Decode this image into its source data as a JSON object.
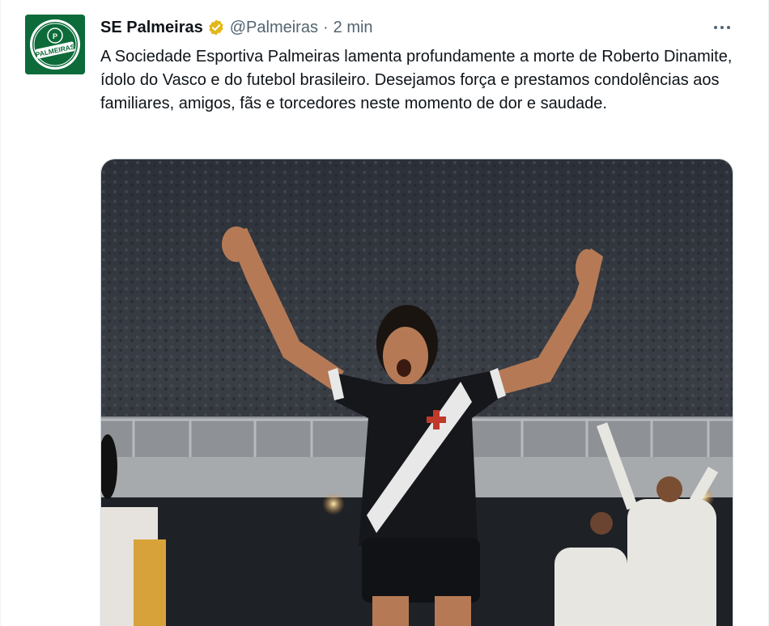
{
  "tweet": {
    "author_name": "SE Palmeiras",
    "handle": "@Palmeiras",
    "separator": "·",
    "time": "2 min",
    "text": "A Sociedade Esportiva Palmeiras lamenta profundamente a morte de Roberto Dinamite, ídolo do Vasco e do futebol brasileiro. Desejamos força e prestamos condolências aos familiares, amigos, fãs e torcedores neste momento de dor e saudade.",
    "avatar_text": "PALMEIRAS",
    "verified_icon": "verified-badge-gold",
    "more_icon": "more-horizontal-icon"
  },
  "colors": {
    "verified": "#e2b719",
    "brand_green": "#0d6b3a",
    "secondary_text": "#536471"
  }
}
